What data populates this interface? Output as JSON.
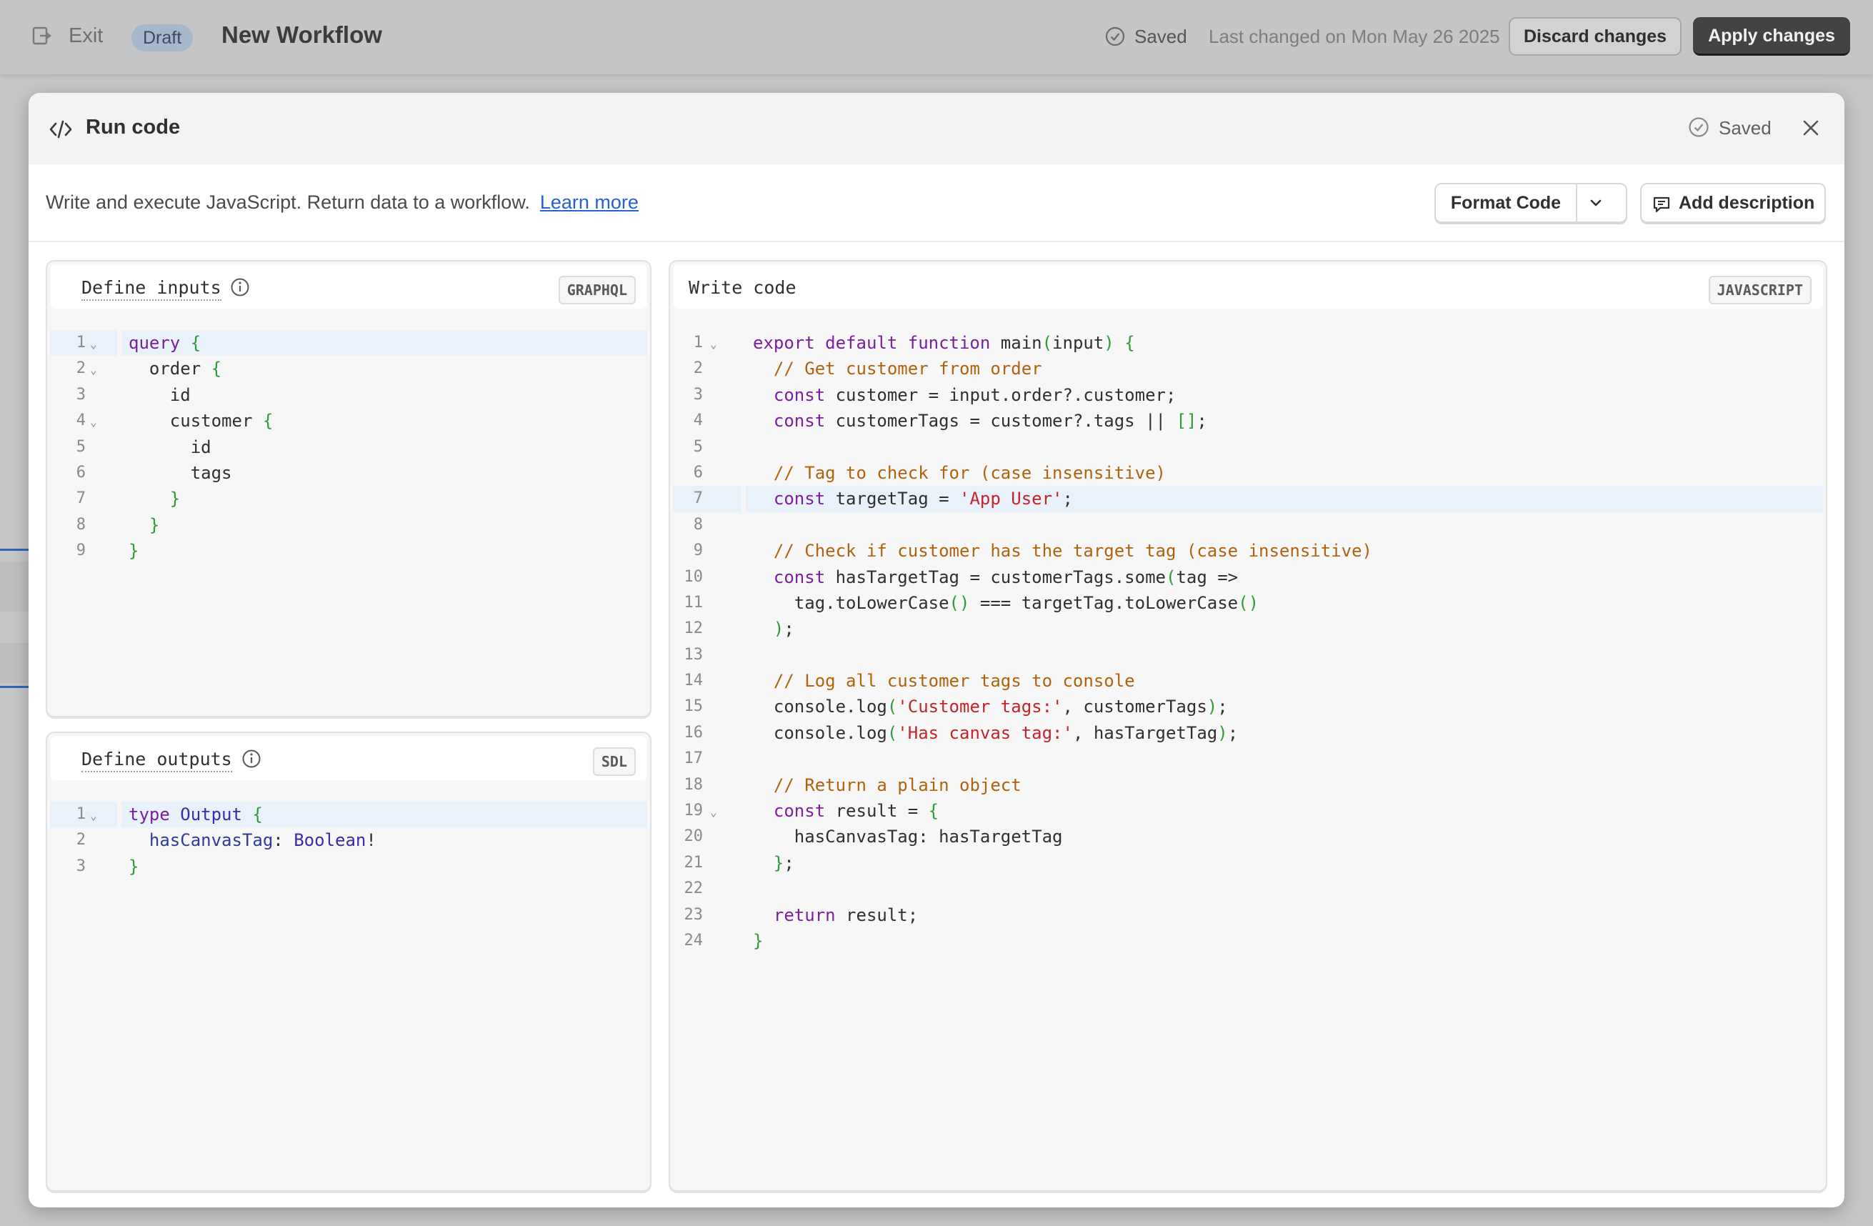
{
  "topbar": {
    "exit_label": "Exit",
    "draft_badge": "Draft",
    "title": "New Workflow",
    "saved_label": "Saved",
    "last_changed": "Last changed on Mon May 26 2025",
    "discard_label": "Discard changes",
    "apply_label": "Apply changes"
  },
  "modal": {
    "title": "Run code",
    "saved_label": "Saved",
    "description": "Write and execute JavaScript. Return data to a workflow.",
    "learn_more": "Learn more",
    "format_code_label": "Format Code",
    "add_description_label": "Add description"
  },
  "inputs_panel": {
    "title": "Define inputs",
    "language": "GRAPHQL",
    "lines": [
      {
        "n": "1",
        "fold": true,
        "hl": true,
        "html": "<span class=\"k\">query</span> <span class=\"b\">{</span>"
      },
      {
        "n": "2",
        "fold": true,
        "html": "  order <span class=\"b\">{</span>"
      },
      {
        "n": "3",
        "html": "    id"
      },
      {
        "n": "4",
        "fold": true,
        "html": "    customer <span class=\"b\">{</span>"
      },
      {
        "n": "5",
        "html": "      id"
      },
      {
        "n": "6",
        "html": "      tags"
      },
      {
        "n": "7",
        "html": "    <span class=\"b\">}</span>"
      },
      {
        "n": "8",
        "html": "  <span class=\"b\">}</span>"
      },
      {
        "n": "9",
        "html": "<span class=\"b\">}</span>"
      }
    ]
  },
  "outputs_panel": {
    "title": "Define outputs",
    "language": "SDL",
    "lines": [
      {
        "n": "1",
        "fold": true,
        "hl": true,
        "html": "<span class=\"k\">type</span> <span class=\"t\">Output</span> <span class=\"b\">{</span>"
      },
      {
        "n": "2",
        "html": "  <span class=\"p\">hasCanvasTag</span>: <span class=\"t\">Boolean</span>!"
      },
      {
        "n": "3",
        "html": "<span class=\"b\">}</span>"
      }
    ]
  },
  "code_panel": {
    "title": "Write code",
    "language": "JAVASCRIPT",
    "lines": [
      {
        "n": "1",
        "fold": true,
        "html": "<span class=\"k\">export default function</span> main<span class=\"b\">(</span>input<span class=\"b\">)</span> <span class=\"b\">{</span>"
      },
      {
        "n": "2",
        "html": "  <span class=\"c\">// Get customer from order</span>"
      },
      {
        "n": "3",
        "html": "  <span class=\"k\">const</span> customer = input.order?.customer;"
      },
      {
        "n": "4",
        "html": "  <span class=\"k\">const</span> customerTags = customer?.tags || <span class=\"b\">[]</span>;"
      },
      {
        "n": "5",
        "html": ""
      },
      {
        "n": "6",
        "html": "  <span class=\"c\">// Tag to check for (case insensitive)</span>"
      },
      {
        "n": "7",
        "hl": true,
        "html": "  <span class=\"k\">const</span> targetTag = <span class=\"s\">'App User'</span>;"
      },
      {
        "n": "8",
        "html": ""
      },
      {
        "n": "9",
        "html": "  <span class=\"c\">// Check if customer has the target tag (case insensitive)</span>"
      },
      {
        "n": "10",
        "html": "  <span class=\"k\">const</span> hasTargetTag = customerTags.some<span class=\"b\">(</span>tag =>"
      },
      {
        "n": "11",
        "html": "    tag.toLowerCase<span class=\"b\">()</span> === targetTag.toLowerCase<span class=\"b\">()</span>"
      },
      {
        "n": "12",
        "html": "  <span class=\"b\">)</span>;"
      },
      {
        "n": "13",
        "html": ""
      },
      {
        "n": "14",
        "html": "  <span class=\"c\">// Log all customer tags to console</span>"
      },
      {
        "n": "15",
        "html": "  console.log<span class=\"b\">(</span><span class=\"s\">'Customer tags:'</span>, customerTags<span class=\"b\">)</span>;"
      },
      {
        "n": "16",
        "html": "  console.log<span class=\"b\">(</span><span class=\"s\">'Has canvas tag:'</span>, hasTargetTag<span class=\"b\">)</span>;"
      },
      {
        "n": "17",
        "html": ""
      },
      {
        "n": "18",
        "html": "  <span class=\"c\">// Return a plain object</span>"
      },
      {
        "n": "19",
        "fold": true,
        "html": "  <span class=\"k\">const</span> result = <span class=\"b\">{</span>"
      },
      {
        "n": "20",
        "html": "    hasCanvasTag: hasTargetTag"
      },
      {
        "n": "21",
        "html": "  <span class=\"b\">}</span>;"
      },
      {
        "n": "22",
        "html": ""
      },
      {
        "n": "23",
        "html": "  <span class=\"k\">return</span> result;"
      },
      {
        "n": "24",
        "html": "<span class=\"b\">}</span>"
      }
    ]
  },
  "icons": {
    "exit": "exit-icon",
    "saved": "check-circle-icon",
    "code": "code-icon",
    "close": "close-icon",
    "chevron": "chevron-down-icon",
    "comment": "comment-icon",
    "info": "info-icon"
  }
}
